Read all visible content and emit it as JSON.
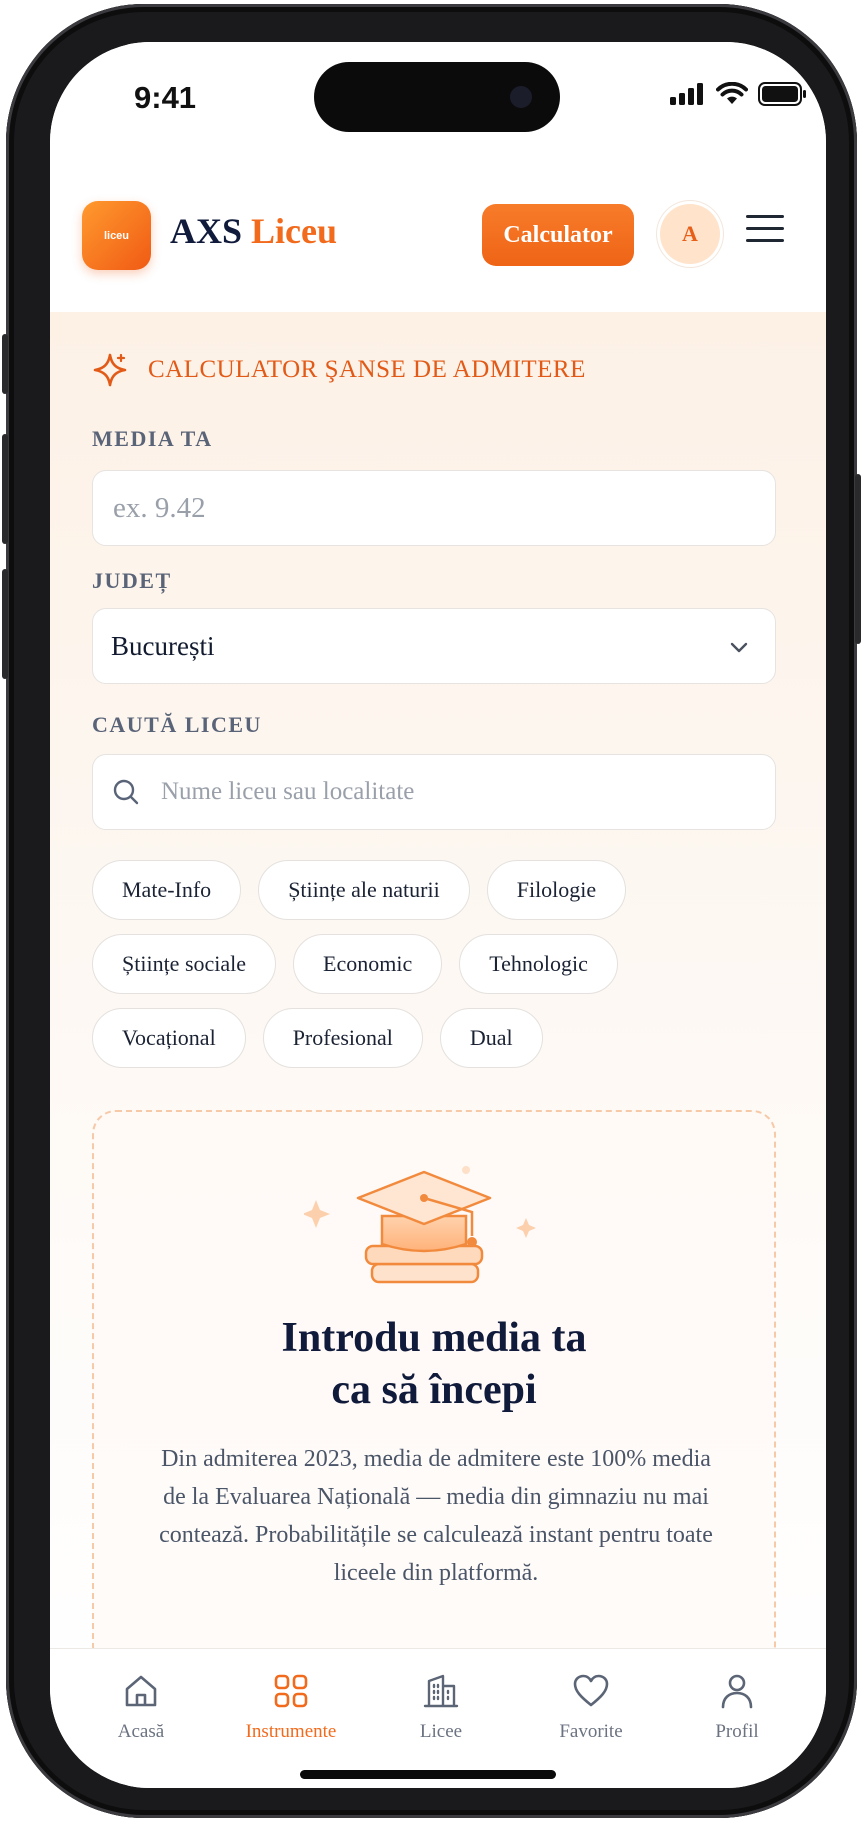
{
  "status_bar": {
    "time": "9:41"
  },
  "header": {
    "logo_text": "liceu",
    "brand_main": "AXS",
    "brand_accent": "Liceu",
    "calculator_button": "Calculator",
    "avatar_initial": "A"
  },
  "calculator": {
    "section_title": "CALCULATOR ŞANSE DE ADMITERE",
    "average_label": "MEDIA TA",
    "average_placeholder": "ex. 9.42",
    "county_label": "JUDEȚ",
    "county_value": "București",
    "search_label": "CAUTĂ LICEU",
    "search_placeholder": "Nume liceu sau localitate",
    "profile_chips": [
      [
        "Mate-Info",
        "Științe ale naturii",
        "Filologie"
      ],
      [
        "Științe sociale",
        "Economic",
        "Tehnologic"
      ],
      [
        "Vocațional",
        "Profesional",
        "Dual"
      ]
    ]
  },
  "empty_state": {
    "title_line1": "Introdu media ta",
    "title_line2": "ca să începi",
    "description": "Din admiterea 2023, media de admitere este 100% media de la Evaluarea Națională — media din gimnaziu nu mai contează. Probabilitățile se calculează instant pentru toate liceele din platformă."
  },
  "tab_bar": {
    "items": [
      {
        "label": "Acasă",
        "icon": "home-icon",
        "active": false
      },
      {
        "label": "Instrumente",
        "icon": "grid-icon",
        "active": true
      },
      {
        "label": "Licee",
        "icon": "building-icon",
        "active": false
      },
      {
        "label": "Favorite",
        "icon": "heart-icon",
        "active": false
      },
      {
        "label": "Profil",
        "icon": "user-icon",
        "active": false
      }
    ]
  },
  "colors": {
    "accent": "#f26a1b",
    "navy": "#101a3a",
    "muted_text": "#5a6478"
  }
}
